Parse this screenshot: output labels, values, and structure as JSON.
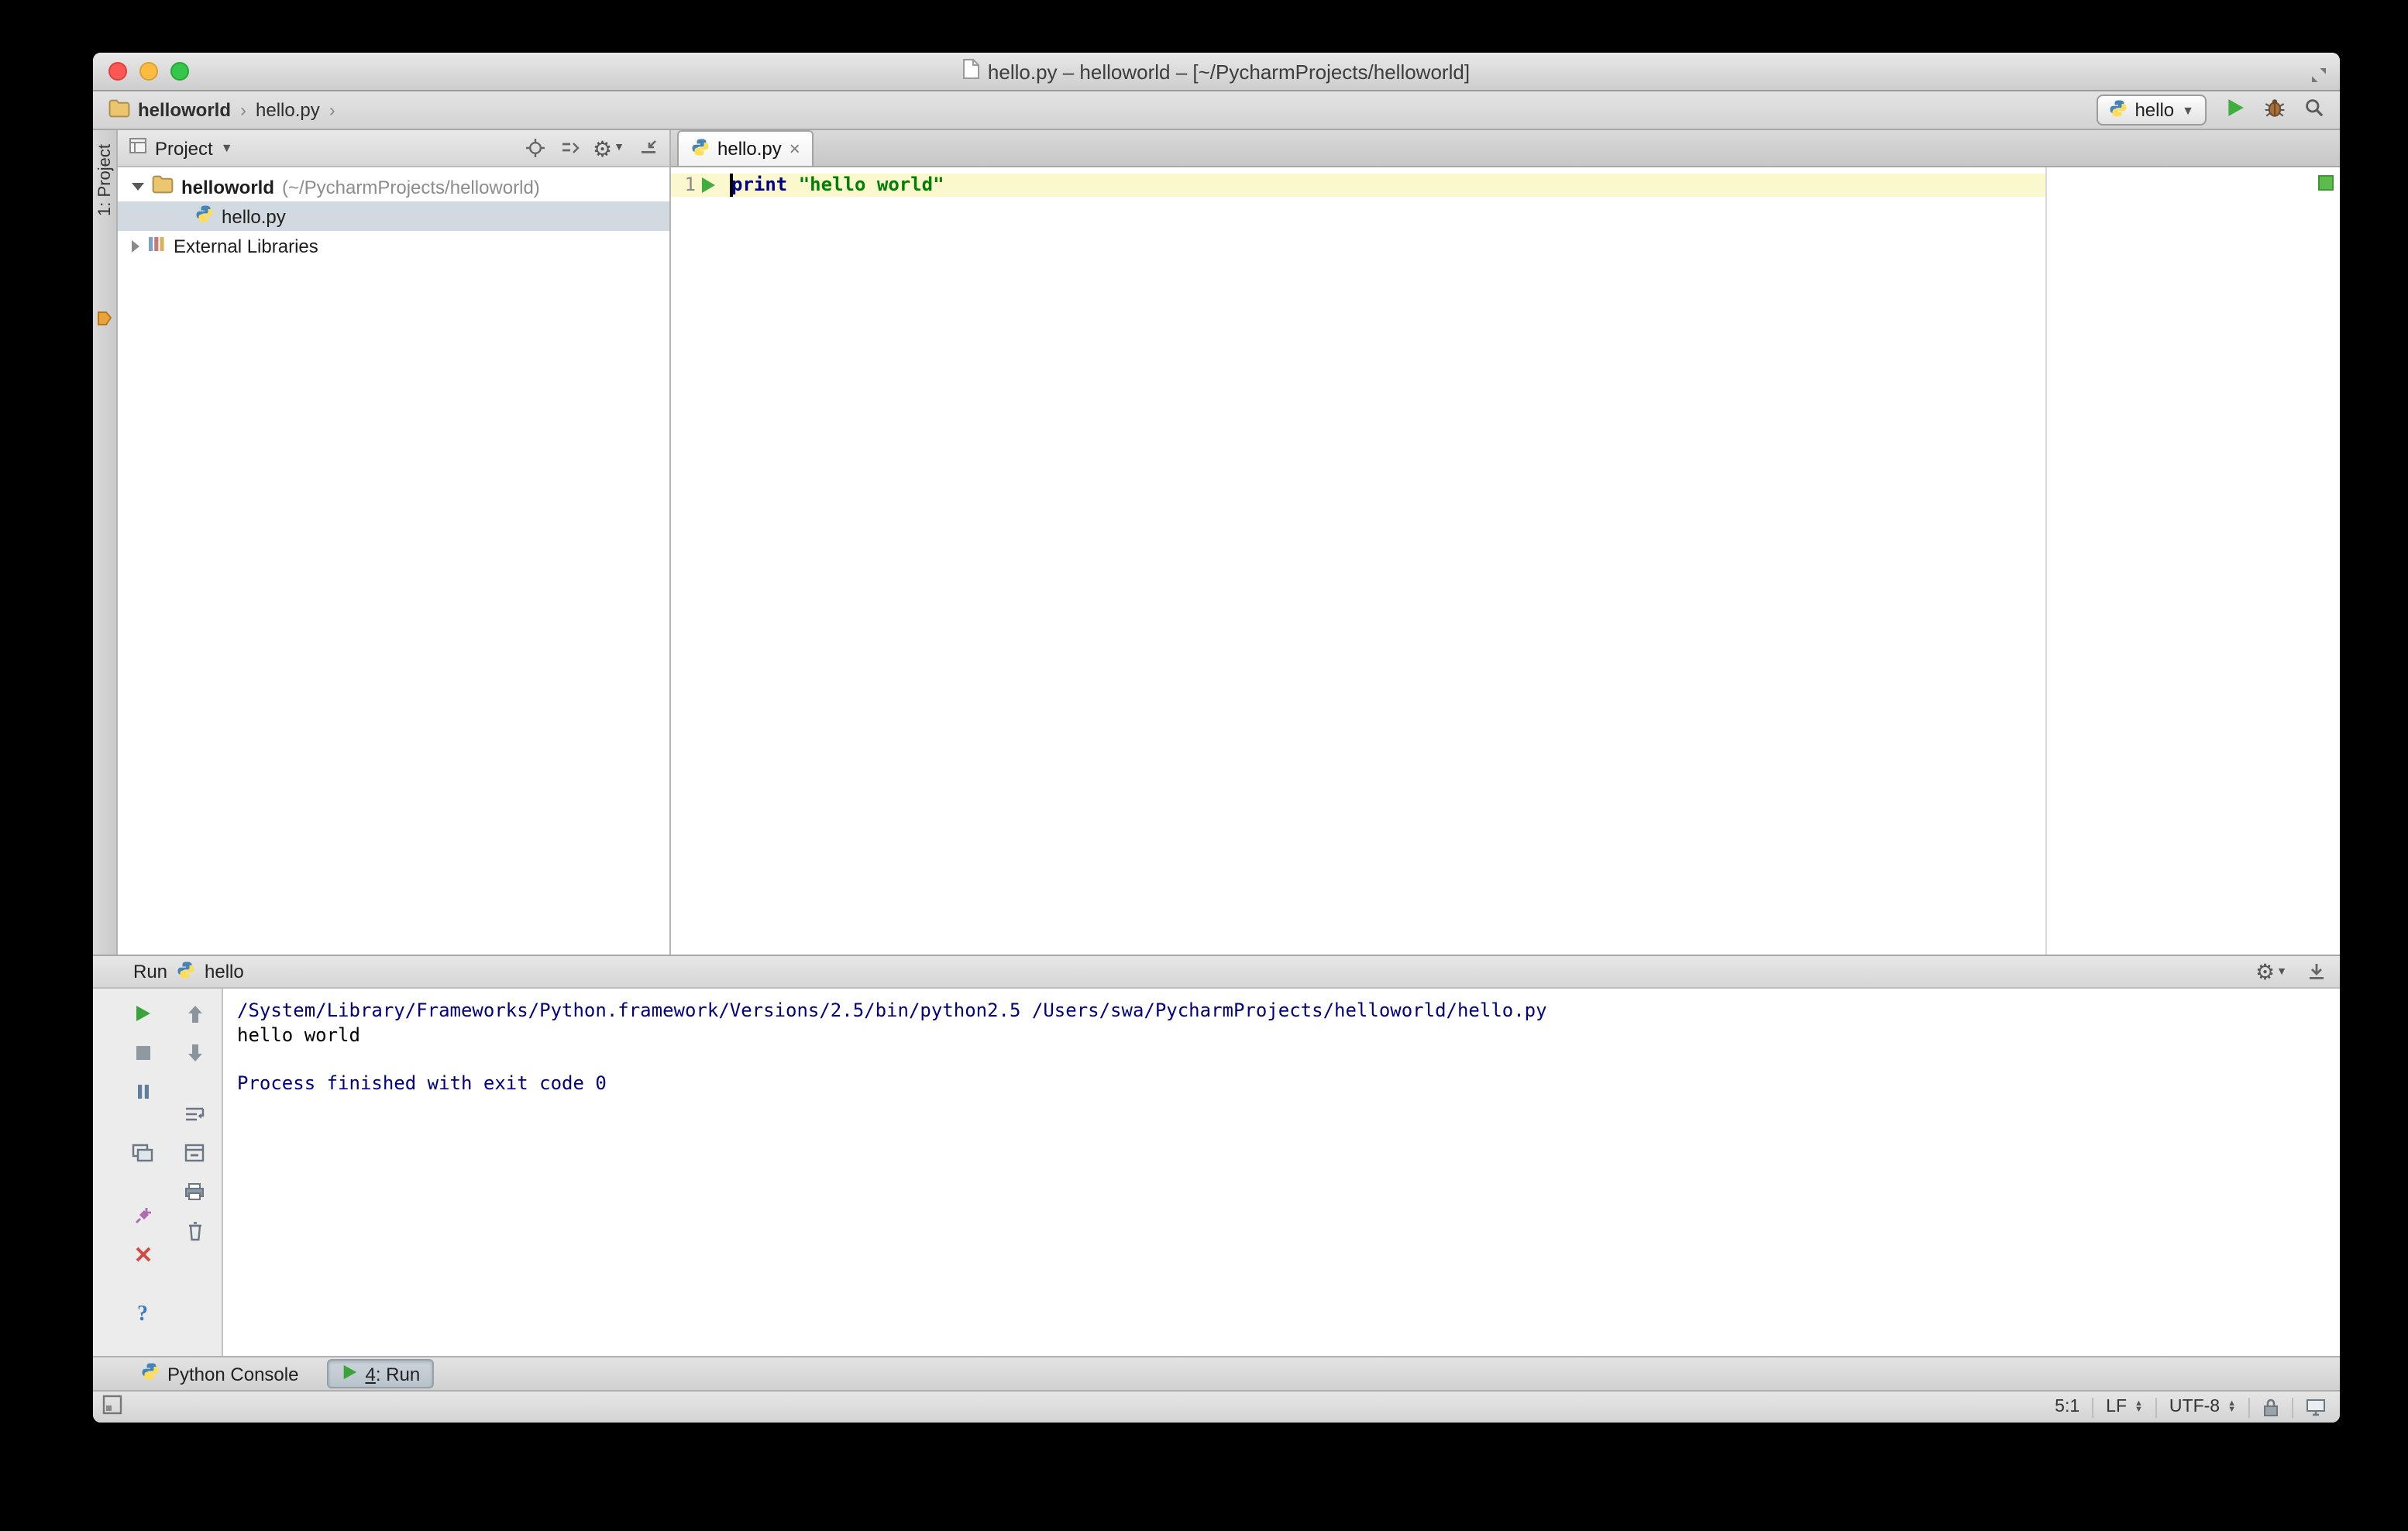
{
  "titlebar": {
    "title": "hello.py – helloworld – [~/PycharmProjects/helloworld]"
  },
  "navbar": {
    "chevron": "›",
    "breadcrumb": [
      {
        "label": "helloworld"
      },
      {
        "label": "hello.py"
      }
    ],
    "run_config": "hello"
  },
  "tool_stripe": {
    "project_label": "1: Project"
  },
  "project_panel": {
    "header_label": "Project",
    "root_name": "helloworld",
    "root_path": "(~/PycharmProjects/helloworld)",
    "file_name": "hello.py",
    "external_libraries": "External Libraries"
  },
  "editor": {
    "tab_label": "hello.py",
    "tab_close": "×",
    "line_number": "1",
    "code_keyword": "print",
    "code_string": "\"hello world\""
  },
  "run_panel": {
    "label": "Run",
    "config": "hello",
    "console": [
      "/System/Library/Frameworks/Python.framework/Versions/2.5/bin/python2.5 /Users/swa/PycharmProjects/helloworld/hello.py",
      "hello world",
      "",
      "Process finished with exit code 0"
    ]
  },
  "bottom_bar": {
    "python_console": "Python Console",
    "run_mnemonic": "4",
    "run_label": ": Run"
  },
  "status_bar": {
    "caret": "5:1",
    "line_sep": "LF",
    "encoding": "UTF-8"
  },
  "colors": {
    "keyword": "#000080",
    "string": "#008000",
    "console_system": "#000080",
    "caret_row": "#fbf8cd",
    "run_green": "#3aa33a",
    "selection": "#d2dae1"
  }
}
